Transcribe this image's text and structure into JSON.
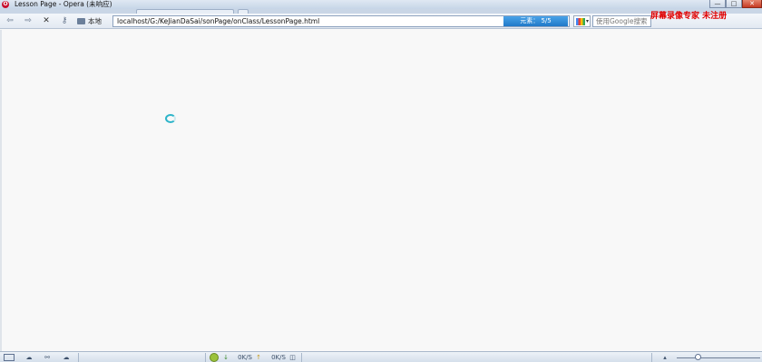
{
  "window": {
    "title": "Lesson Page - Opera (未响应)",
    "logo": "O",
    "minimize_icon": "—",
    "maximize_icon": "□",
    "close_icon": "✕"
  },
  "toolbar": {
    "back_icon": "⇦",
    "forward_icon": "⇨",
    "stop_icon": "✕",
    "key_icon": "⚷",
    "location_label": "本地",
    "address": "localhost/G:/KeJianDaSai/sonPage/onClass/LessonPage.html",
    "progress_text": "元素：  5/5",
    "progress_fraction": 1.0,
    "search_placeholder": "使用Google搜索",
    "search_dropdown_icon": "▾"
  },
  "overlay": {
    "watermark": "屏幕录像专家  未注册"
  },
  "statusbar": {
    "panel_icon": "▭",
    "cloud_icon": "☁",
    "share_icon": "⚯",
    "unite_icon": "☁",
    "down_arrow": "↓",
    "down_speed": "0K/S",
    "up_arrow": "↑",
    "up_speed": "0K/S",
    "net_icon": "◫",
    "zoom_up_icon": "▴",
    "zoom_level_fraction": 0.25
  },
  "colors": {
    "accent": "#1f78c8",
    "watermark": "#e00000",
    "spinner": "#2cb4c9"
  }
}
